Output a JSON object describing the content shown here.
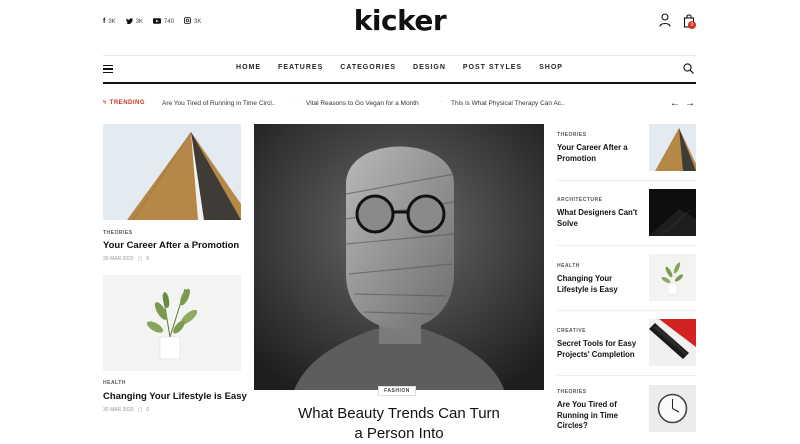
{
  "header": {
    "logo": "kicker",
    "socials": [
      {
        "icon": "facebook-icon",
        "glyph": "f",
        "count": "3K"
      },
      {
        "icon": "twitter-icon",
        "glyph": "t",
        "count": "3K"
      },
      {
        "icon": "youtube-icon",
        "glyph": "▶",
        "count": "740"
      },
      {
        "icon": "instagram-icon",
        "glyph": "◎",
        "count": "3K"
      }
    ],
    "cart_count": "0"
  },
  "nav": {
    "items": [
      "HOME",
      "FEATURES",
      "CATEGORIES",
      "DESIGN",
      "POST STYLES",
      "SHOP"
    ]
  },
  "trending": {
    "label": "TRENDING",
    "items": [
      "Are You Tired of Running in Time Circl..",
      "Vital Reasons to Go Vegan for a Month",
      "This is What Physical Therapy Can Ac.."
    ]
  },
  "left_posts": [
    {
      "category": "THEORIES",
      "title": "Your Career After a Promotion",
      "date": "30 MAR 2020",
      "comments": "0"
    },
    {
      "category": "HEALTH",
      "title": "Changing Your Lifestyle is Easy",
      "date": "30 MAR 2020",
      "comments": "0"
    }
  ],
  "hero": {
    "category": "FASHION",
    "title_line1": "What Beauty Trends Can Turn",
    "title_line2": "a Person Into"
  },
  "side_posts": [
    {
      "category": "THEORIES",
      "title": "Your Career After a Promotion"
    },
    {
      "category": "ARCHITECTURE",
      "title": "What Designers Can't Solve"
    },
    {
      "category": "HEALTH",
      "title": "Changing Your Lifestyle is Easy"
    },
    {
      "category": "CREATIVE",
      "title": "Secret Tools for Easy Projects' Completion"
    },
    {
      "category": "THEORIES",
      "title": "Are You Tired of Running in Time Circles?"
    }
  ],
  "colors": {
    "accent": "#d2341c",
    "text": "#111111"
  }
}
